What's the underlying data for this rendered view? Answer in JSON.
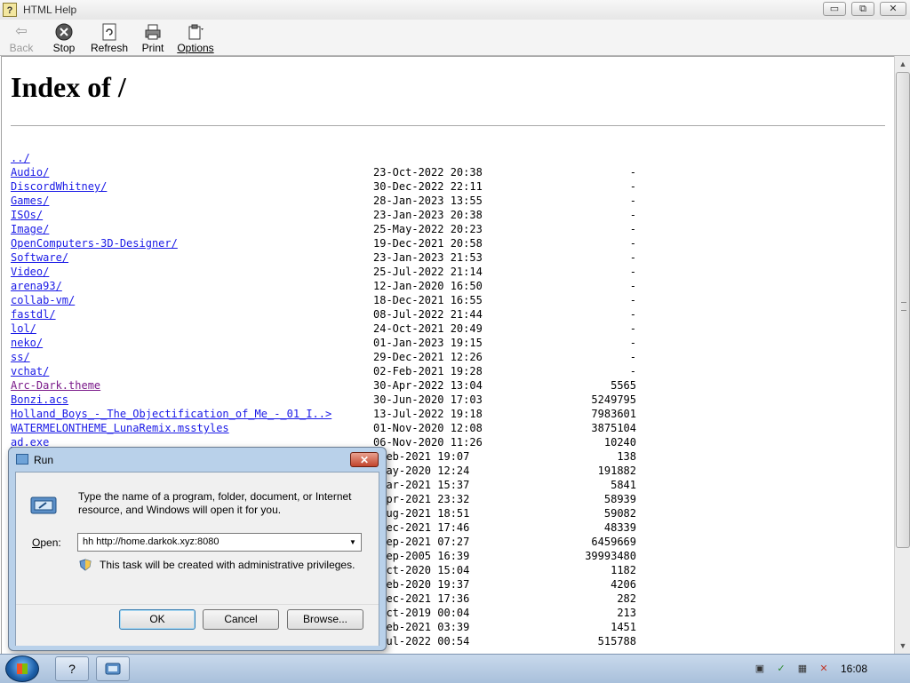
{
  "window": {
    "title": "HTML Help",
    "controls": {
      "minimize": "▭",
      "maximize": "⧉",
      "close": "✕"
    }
  },
  "toolbar": {
    "items": [
      {
        "label": "Back",
        "icon": "back-arrow-icon",
        "enabled": false
      },
      {
        "label": "Stop",
        "icon": "stop-icon",
        "enabled": true
      },
      {
        "label": "Refresh",
        "icon": "refresh-icon",
        "enabled": true
      },
      {
        "label": "Print",
        "icon": "printer-icon",
        "enabled": true
      },
      {
        "label": "Options",
        "icon": "options-icon",
        "enabled": true
      }
    ]
  },
  "page": {
    "heading": "Index of /",
    "entries": [
      {
        "name": "../",
        "date": "",
        "size": ""
      },
      {
        "name": "Audio/",
        "date": "23-Oct-2022 20:38",
        "size": "-"
      },
      {
        "name": "DiscordWhitney/",
        "date": "30-Dec-2022 22:11",
        "size": "-"
      },
      {
        "name": "Games/",
        "date": "28-Jan-2023 13:55",
        "size": "-"
      },
      {
        "name": "ISOs/",
        "date": "23-Jan-2023 20:38",
        "size": "-"
      },
      {
        "name": "Image/",
        "date": "25-May-2022 20:23",
        "size": "-"
      },
      {
        "name": "OpenComputers-3D-Designer/",
        "date": "19-Dec-2021 20:58",
        "size": "-"
      },
      {
        "name": "Software/",
        "date": "23-Jan-2023 21:53",
        "size": "-"
      },
      {
        "name": "Video/",
        "date": "25-Jul-2022 21:14",
        "size": "-"
      },
      {
        "name": "arena93/",
        "date": "12-Jan-2020 16:50",
        "size": "-"
      },
      {
        "name": "collab-vm/",
        "date": "18-Dec-2021 16:55",
        "size": "-"
      },
      {
        "name": "fastdl/",
        "date": "08-Jul-2022 21:44",
        "size": "-"
      },
      {
        "name": "lol/",
        "date": "24-Oct-2021 20:49",
        "size": "-"
      },
      {
        "name": "neko/",
        "date": "01-Jan-2023 19:15",
        "size": "-"
      },
      {
        "name": "ss/",
        "date": "29-Dec-2021 12:26",
        "size": "-"
      },
      {
        "name": "vchat/",
        "date": "02-Feb-2021 19:28",
        "size": "-"
      },
      {
        "name": "Arc-Dark.theme",
        "date": "30-Apr-2022 13:04",
        "size": "5565",
        "visited": true
      },
      {
        "name": "Bonzi.acs",
        "date": "30-Jun-2020 17:03",
        "size": "5249795"
      },
      {
        "name": "Holland_Boys_-_The_Objectification_of_Me_-_01_I..>",
        "date": "13-Jul-2022 19:18",
        "size": "7983601"
      },
      {
        "name": "WATERMELONTHEME_LunaRemix.msstyles",
        "date": "01-Nov-2020 12:08",
        "size": "3875104"
      },
      {
        "name": "ad.exe",
        "date": "06-Nov-2020 11:26",
        "size": "10240"
      },
      {
        "name": "",
        "date": "-Feb-2021 19:07",
        "size": "138"
      },
      {
        "name": "",
        "date": "-May-2020 12:24",
        "size": "191882"
      },
      {
        "name": "",
        "date": "-Mar-2021 15:37",
        "size": "5841"
      },
      {
        "name": "",
        "date": "-Apr-2021 23:32",
        "size": "58939"
      },
      {
        "name": "",
        "date": "-Aug-2021 18:51",
        "size": "59082"
      },
      {
        "name": "",
        "date": "-Dec-2021 17:46",
        "size": "48339"
      },
      {
        "name": "",
        "date": "-Sep-2021 07:27",
        "size": "6459669"
      },
      {
        "name": "",
        "date": "-Sep-2005 16:39",
        "size": "39993480"
      },
      {
        "name": "",
        "date": "-Oct-2020 15:04",
        "size": "1182"
      },
      {
        "name": "",
        "date": "-Feb-2020 19:37",
        "size": "4206"
      },
      {
        "name": "",
        "date": "-Dec-2021 17:36",
        "size": "282"
      },
      {
        "name": "",
        "date": "-Oct-2019 00:04",
        "size": "213"
      },
      {
        "name": "",
        "date": "-Feb-2021 03:39",
        "size": "1451"
      },
      {
        "name": "",
        "date": "-Jul-2022 00:54",
        "size": "515788"
      }
    ]
  },
  "run_dialog": {
    "title": "Run",
    "description": "Type the name of a program, folder, document, or Internet resource, and Windows will open it for you.",
    "open_label": "Open:",
    "open_value": "hh http://home.darkok.xyz:8080",
    "admin_note": "This task will be created with administrative privileges.",
    "ok": "OK",
    "cancel": "Cancel",
    "browse": "Browse..."
  },
  "taskbar": {
    "clock": "16:08",
    "tray_icons": [
      "action-center-icon",
      "network-icon",
      "volume-muted-icon"
    ]
  },
  "colors": {
    "link": "#1a1ae6",
    "visited": "#7a1a8a",
    "close_red": "#c2452c"
  }
}
